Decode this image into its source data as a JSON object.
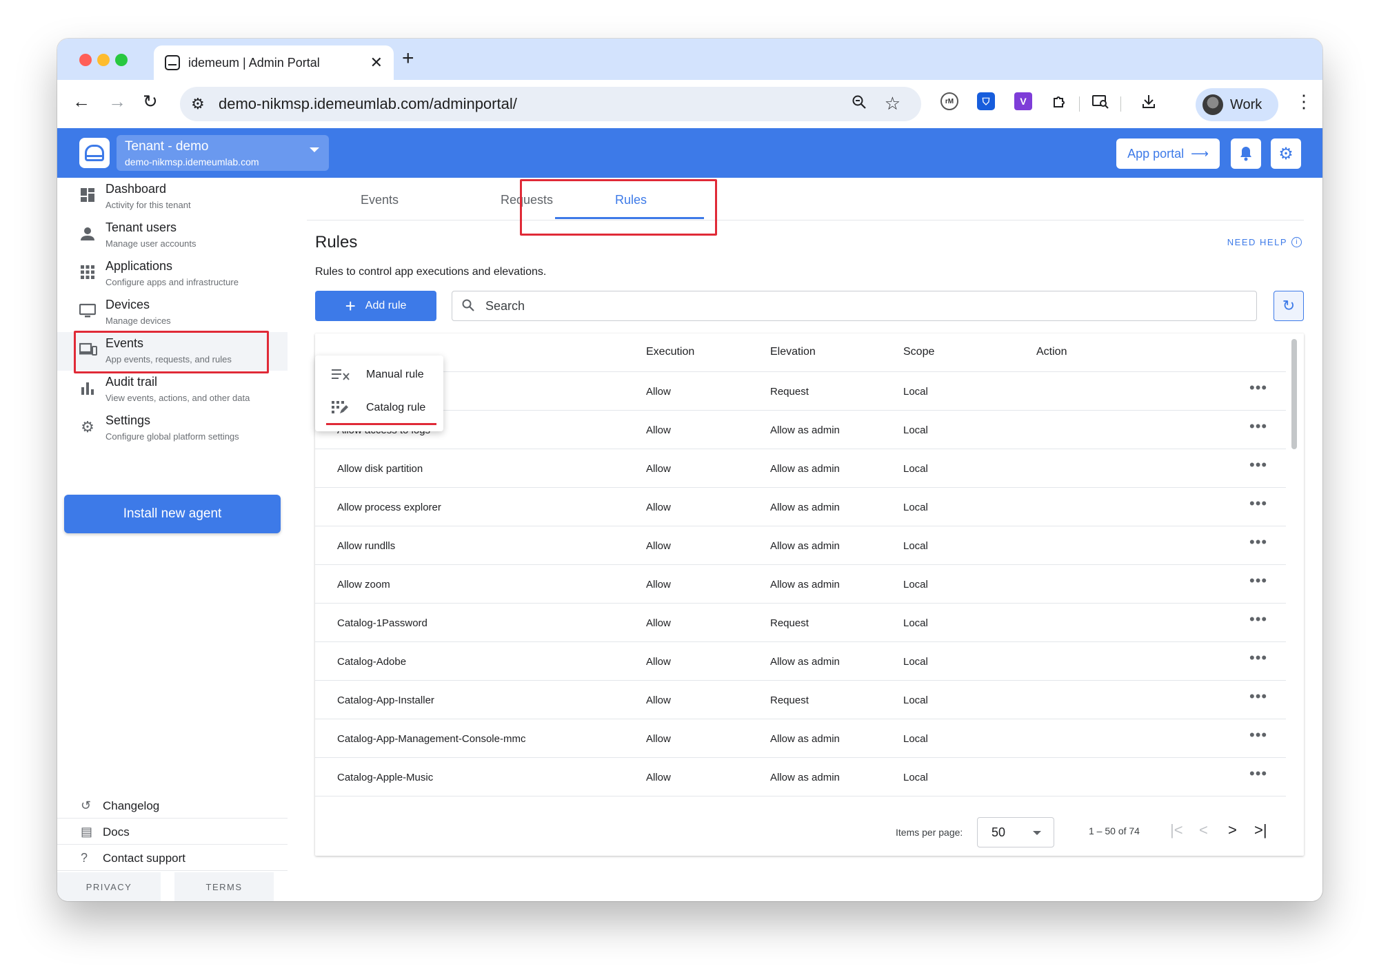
{
  "browser": {
    "tab_title": "idemeum | Admin Portal",
    "url": "demo-nikmsp.idemeumlab.com/adminportal/",
    "profile_label": "Work"
  },
  "header": {
    "tenant_name": "Tenant - demo",
    "tenant_domain": "demo-nikmsp.idemeumlab.com",
    "app_portal_label": "App portal"
  },
  "sidebar": {
    "items": [
      {
        "label": "Dashboard",
        "sub": "Activity for this tenant",
        "icon": "dashboard-icon"
      },
      {
        "label": "Tenant users",
        "sub": "Manage user accounts",
        "icon": "person-icon"
      },
      {
        "label": "Applications",
        "sub": "Configure apps and infrastructure",
        "icon": "apps-grid-icon"
      },
      {
        "label": "Devices",
        "sub": "Manage devices",
        "icon": "monitor-icon"
      },
      {
        "label": "Events",
        "sub": "App events, requests, and rules",
        "icon": "devices-icon"
      },
      {
        "label": "Audit trail",
        "sub": "View events, actions, and other data",
        "icon": "bar-chart-icon"
      },
      {
        "label": "Settings",
        "sub": "Configure global platform settings",
        "icon": "gear-icon"
      }
    ],
    "install_label": "Install new agent",
    "footer": [
      {
        "label": "Changelog",
        "icon": "history-icon"
      },
      {
        "label": "Docs",
        "icon": "document-icon"
      },
      {
        "label": "Contact support",
        "icon": "help-icon"
      }
    ],
    "privacy_label": "PRIVACY",
    "terms_label": "TERMS"
  },
  "main": {
    "tabs": [
      {
        "label": "Events"
      },
      {
        "label": "Requests"
      },
      {
        "label": "Rules"
      }
    ],
    "active_tab": "Rules",
    "title": "Rules",
    "need_help": "NEED HELP",
    "description": "Rules to control app executions and elevations.",
    "add_rule_label": "Add rule",
    "search_placeholder": "Search",
    "menu": [
      {
        "label": "Manual rule",
        "icon": "manual-rule-icon"
      },
      {
        "label": "Catalog rule",
        "icon": "catalog-rule-icon"
      }
    ],
    "columns": [
      "Execution",
      "Elevation",
      "Scope",
      "Action"
    ],
    "rows": [
      {
        "name": "",
        "execution": "Allow",
        "elevation": "Request",
        "scope": "Local"
      },
      {
        "name": "Allow access to logs",
        "execution": "Allow",
        "elevation": "Allow as admin",
        "scope": "Local"
      },
      {
        "name": "Allow disk partition",
        "execution": "Allow",
        "elevation": "Allow as admin",
        "scope": "Local"
      },
      {
        "name": "Allow process explorer",
        "execution": "Allow",
        "elevation": "Allow as admin",
        "scope": "Local"
      },
      {
        "name": "Allow rundlls",
        "execution": "Allow",
        "elevation": "Allow as admin",
        "scope": "Local"
      },
      {
        "name": "Allow zoom",
        "execution": "Allow",
        "elevation": "Allow as admin",
        "scope": "Local"
      },
      {
        "name": "Catalog-1Password",
        "execution": "Allow",
        "elevation": "Request",
        "scope": "Local"
      },
      {
        "name": "Catalog-Adobe",
        "execution": "Allow",
        "elevation": "Allow as admin",
        "scope": "Local"
      },
      {
        "name": "Catalog-App-Installer",
        "execution": "Allow",
        "elevation": "Request",
        "scope": "Local"
      },
      {
        "name": "Catalog-App-Management-Console-mmc",
        "execution": "Allow",
        "elevation": "Allow as admin",
        "scope": "Local"
      },
      {
        "name": "Catalog-Apple-Music",
        "execution": "Allow",
        "elevation": "Allow as admin",
        "scope": "Local"
      }
    ],
    "paginator": {
      "items_label": "Items per page:",
      "page_size": "50",
      "range": "1 – 50 of 74"
    }
  },
  "colors": {
    "brand_blue": "#3d7ae8",
    "highlight_red": "#e02a37"
  }
}
